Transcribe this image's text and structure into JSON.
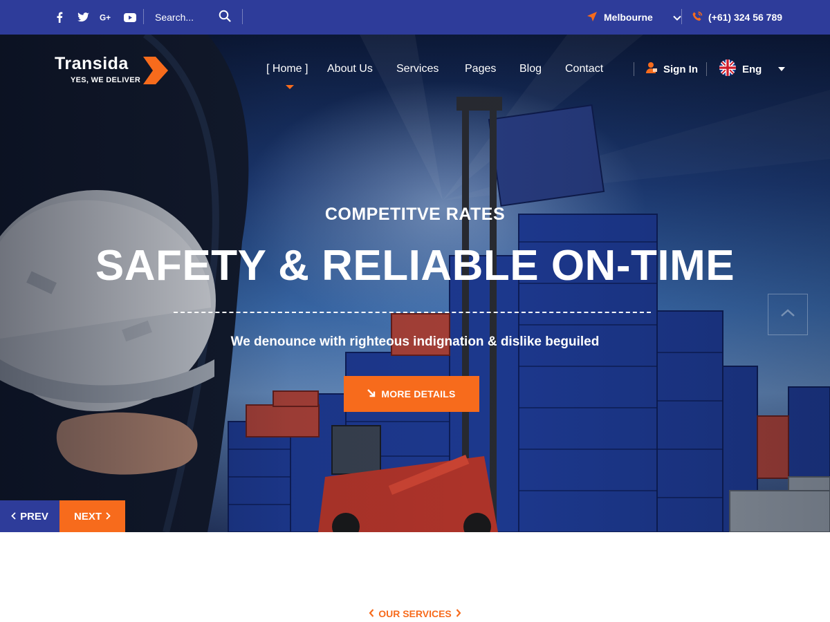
{
  "topbar": {
    "social": [
      "facebook-icon",
      "twitter-icon",
      "google-plus-icon",
      "youtube-icon"
    ],
    "search_placeholder": "Search...",
    "location": "Melbourne",
    "phone": "(+61) 324 56 789"
  },
  "brand": {
    "name": "Transida",
    "tagline": "YES, WE DELIVER"
  },
  "nav": {
    "home": "[ Home ]",
    "about": "About Us",
    "services": "Services",
    "pages": "Pages",
    "blog": "Blog",
    "contact": "Contact",
    "signin": "Sign In",
    "language": "Eng"
  },
  "hero": {
    "eyebrow": "COMPETITVE RATES",
    "headline": "SAFETY & RELIABLE ON-TIME",
    "subline": "We denounce with righteous indignation & dislike beguiled",
    "cta": "MORE DETAILS",
    "prev": "PREV",
    "next": "NEXT"
  },
  "section": {
    "label": "OUR SERVICES"
  },
  "colors": {
    "primary": "#2e3c9a",
    "accent": "#f76b1c",
    "white": "#ffffff"
  }
}
